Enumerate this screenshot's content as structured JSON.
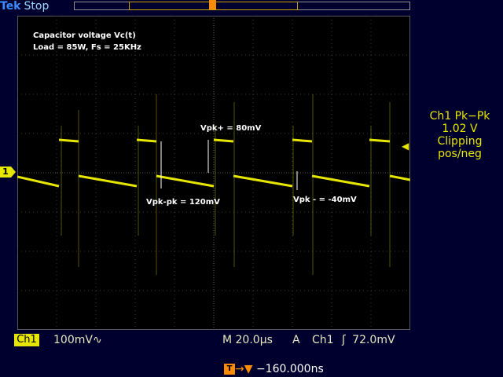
{
  "header": {
    "brand": "Tek",
    "run_state": "Stop"
  },
  "trigger_marker": "T",
  "channel_marker": "1",
  "annotations": {
    "title_line1": "Capacitor voltage Vc(t)",
    "title_line2": "Load = 85W, Fs = 25KHz",
    "vpk_plus": "Vpk+ = 80mV",
    "vpk_pk": "Vpk-pk = 120mV",
    "vpk_minus": "Vpk - = -40mV"
  },
  "measurement": {
    "name": "Ch1 Pk−Pk",
    "value": "1.02 V",
    "status1": "Clipping",
    "status2": "pos/neg"
  },
  "bottom_bar": {
    "channel": "Ch1",
    "scale": "100mV",
    "bandwidth_icon": "∿",
    "timebase": "M 20.0µs",
    "acq_mode": "A",
    "trig_source": "Ch1",
    "trig_slope_icon": "ʃ",
    "trig_level": "72.0mV"
  },
  "trigger_delay": {
    "icon": "T",
    "arrow": "→▼",
    "value": "−160.000ns"
  },
  "colors": {
    "trace": "#e6e600",
    "trigger": "#ff8c00",
    "background": "#00002e"
  }
}
